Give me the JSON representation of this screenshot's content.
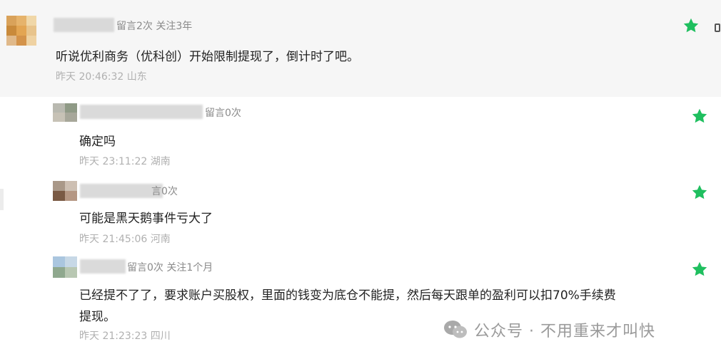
{
  "colors": {
    "star": "#1fbf5f",
    "meta": "#8a8a8a",
    "time": "#b0b0b0",
    "highlight_bg": "#f6f6f6"
  },
  "comments": [
    {
      "meta": "留言2次 关注3年",
      "text": "听说优利商务（优科创）开始限制提现了，倒计时了吧。",
      "time": "昨天 20:46:32 山东"
    },
    {
      "meta": "留言0次",
      "text": "确定吗",
      "time": "昨天 23:11:22 湖南"
    },
    {
      "meta": "言0次",
      "text": "可能是黑天鹅事件亏大了",
      "time": "昨天 21:45:06 河南"
    },
    {
      "meta": "留言0次 关注1个月",
      "text_line1": "已经提不了了，要求账户买股权，里面的钱变为底仓不能提，然后每天跟单的盈利可以扣70%手续费",
      "text_line2": "提现。",
      "time": "昨天 21:23:23 四川"
    }
  ],
  "icons": {
    "star": "star-icon",
    "wechat": "wechat-icon"
  },
  "watermark": {
    "text": "公众号 · 不用重来才叫快"
  }
}
